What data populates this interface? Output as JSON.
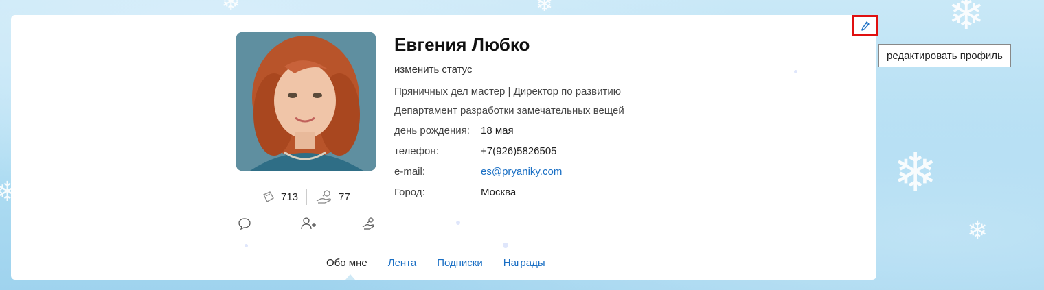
{
  "profile": {
    "name": "Евгения Любко",
    "status_link": "изменить статус",
    "position": "Пряничных дел мастер | Директор по развитию",
    "department": "Департамент разработки замечательных вещей",
    "birthday_label": "день рождения:",
    "birthday_value": "18 мая",
    "phone_label": "телефон:",
    "phone_value": "+7(926)5826505",
    "email_label": "e-mail:",
    "email_value": "es@pryaniky.com",
    "city_label": "Город:",
    "city_value": "Москва"
  },
  "stats": {
    "wallet_count": "713",
    "thanks_count": "77"
  },
  "tabs": [
    {
      "label": "Обо мне",
      "active": true
    },
    {
      "label": "Лента",
      "active": false
    },
    {
      "label": "Подписки",
      "active": false
    },
    {
      "label": "Награды",
      "active": false
    }
  ],
  "edit": {
    "tooltip": "редактировать профиль"
  },
  "colors": {
    "link": "#1a6fc4",
    "highlight": "#e01010"
  }
}
